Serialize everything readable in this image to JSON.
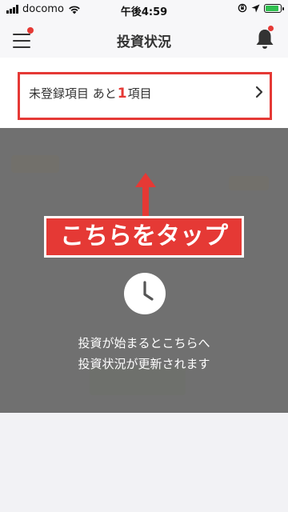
{
  "status_bar": {
    "carrier": "docomo",
    "time": "午後4:59"
  },
  "header": {
    "title": "投資状況"
  },
  "notice": {
    "prefix": "未登録項目 あと",
    "count": "1",
    "suffix": "項目"
  },
  "callout": {
    "label": "こちらをタップ"
  },
  "empty_state": {
    "line1": "投資が始まるとこちらへ",
    "line2": "投資状況が更新されます"
  },
  "colors": {
    "accent": "#e53935",
    "battery": "#2fbf4f"
  }
}
